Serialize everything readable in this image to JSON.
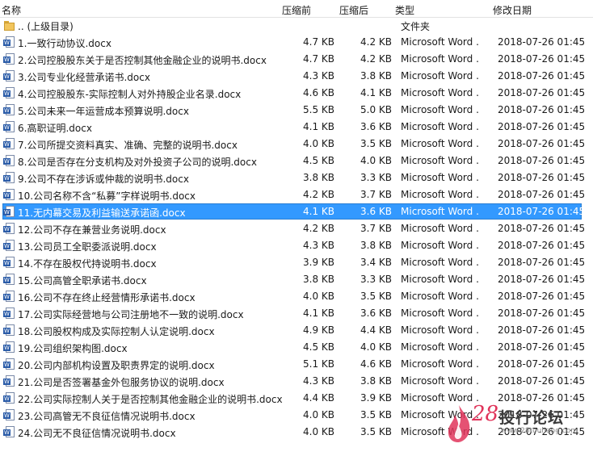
{
  "columns": {
    "name": "名称",
    "size_before": "压缩前",
    "size_after": "压缩后",
    "type": "类型",
    "modified": "修改日期"
  },
  "parent_row": {
    "label": ".. (上级目录)",
    "type": "文件夹",
    "icon": "folder-icon"
  },
  "selected_index": 10,
  "files": [
    {
      "name": "1.一致行动协议.docx",
      "before": "4.7 KB",
      "after": "4.2 KB",
      "type": "Microsoft Word ...",
      "date": "2018-07-26 01:45"
    },
    {
      "name": "2.公司控股股东关于是否控制其他金融企业的说明书.docx",
      "before": "4.7 KB",
      "after": "4.2 KB",
      "type": "Microsoft Word ...",
      "date": "2018-07-26 01:45"
    },
    {
      "name": "3.公司专业化经营承诺书.docx",
      "before": "4.3 KB",
      "after": "3.8 KB",
      "type": "Microsoft Word ...",
      "date": "2018-07-26 01:45"
    },
    {
      "name": "4.公司控股股东-实际控制人对外持股企业名录.docx",
      "before": "4.6 KB",
      "after": "4.1 KB",
      "type": "Microsoft Word ...",
      "date": "2018-07-26 01:45"
    },
    {
      "name": "5.公司未来一年运营成本预算说明.docx",
      "before": "5.5 KB",
      "after": "5.0 KB",
      "type": "Microsoft Word ...",
      "date": "2018-07-26 01:45"
    },
    {
      "name": "6.高职证明.docx",
      "before": "4.1 KB",
      "after": "3.6 KB",
      "type": "Microsoft Word ...",
      "date": "2018-07-26 01:45"
    },
    {
      "name": "7.公司所提交资料真实、准确、完整的说明书.docx",
      "before": "4.0 KB",
      "after": "3.5 KB",
      "type": "Microsoft Word ...",
      "date": "2018-07-26 01:45"
    },
    {
      "name": "8.公司是否存在分支机构及对外投资子公司的说明.docx",
      "before": "4.5 KB",
      "after": "4.0 KB",
      "type": "Microsoft Word ...",
      "date": "2018-07-26 01:45"
    },
    {
      "name": "9.公司不存在涉诉或仲裁的说明书.docx",
      "before": "3.8 KB",
      "after": "3.3 KB",
      "type": "Microsoft Word ...",
      "date": "2018-07-26 01:45"
    },
    {
      "name": "10.公司名称不含“私募”字样说明书.docx",
      "before": "4.2 KB",
      "after": "3.7 KB",
      "type": "Microsoft Word ...",
      "date": "2018-07-26 01:45"
    },
    {
      "name": "11.无内幕交易及利益输送承诺函.docx",
      "before": "4.1 KB",
      "after": "3.6 KB",
      "type": "Microsoft Word ...",
      "date": "2018-07-26 01:45"
    },
    {
      "name": "12.公司不存在兼营业务说明.docx",
      "before": "4.2 KB",
      "after": "3.7 KB",
      "type": "Microsoft Word ...",
      "date": "2018-07-26 01:45"
    },
    {
      "name": "13.公司员工全职委派说明.docx",
      "before": "4.3 KB",
      "after": "3.8 KB",
      "type": "Microsoft Word ...",
      "date": "2018-07-26 01:45"
    },
    {
      "name": "14.不存在股权代持说明书.docx",
      "before": "3.9 KB",
      "after": "3.4 KB",
      "type": "Microsoft Word ...",
      "date": "2018-07-26 01:45"
    },
    {
      "name": "15.公司高管全职承诺书.docx",
      "before": "3.8 KB",
      "after": "3.3 KB",
      "type": "Microsoft Word ...",
      "date": "2018-07-26 01:45"
    },
    {
      "name": "16.公司不存在终止经营情形承诺书.docx",
      "before": "4.0 KB",
      "after": "3.5 KB",
      "type": "Microsoft Word ...",
      "date": "2018-07-26 01:45"
    },
    {
      "name": "17.公司实际经营地与公司注册地不一致的说明.docx",
      "before": "4.1 KB",
      "after": "3.6 KB",
      "type": "Microsoft Word ...",
      "date": "2018-07-26 01:45"
    },
    {
      "name": "18.公司股权构成及实际控制人认定说明.docx",
      "before": "4.9 KB",
      "after": "4.4 KB",
      "type": "Microsoft Word ...",
      "date": "2018-07-26 01:45"
    },
    {
      "name": "19.公司组织架构图.docx",
      "before": "4.5 KB",
      "after": "4.0 KB",
      "type": "Microsoft Word ...",
      "date": "2018-07-26 01:45"
    },
    {
      "name": "20.公司内部机构设置及职责界定的说明.docx",
      "before": "5.1 KB",
      "after": "4.6 KB",
      "type": "Microsoft Word ...",
      "date": "2018-07-26 01:45"
    },
    {
      "name": "21.公司是否签署基金外包服务协议的说明.docx",
      "before": "4.3 KB",
      "after": "3.8 KB",
      "type": "Microsoft Word ...",
      "date": "2018-07-26 01:45"
    },
    {
      "name": "22.公司实际控制人关于是否控制其他金融企业的说明书.docx",
      "before": "4.4 KB",
      "after": "3.9 KB",
      "type": "Microsoft Word ...",
      "date": "2018-07-26 01:45"
    },
    {
      "name": "23.公司高管无不良征信情况说明书.docx",
      "before": "4.0 KB",
      "after": "3.5 KB",
      "type": "Microsoft Word ...",
      "date": "2018-07-26 01:45"
    },
    {
      "name": "24.公司无不良征信情况说明书.docx",
      "before": "4.0 KB",
      "after": "3.5 KB",
      "type": "Microsoft Word ...",
      "date": "2018-07-26 01:45"
    }
  ],
  "watermark": {
    "number": "28",
    "title": "投行论坛",
    "url": "www.28touhang.com"
  },
  "colors": {
    "selection": "#3399ff",
    "word_icon": "#2b5ca8",
    "folder": "#f2c55c",
    "watermark_accent": "#e0345a"
  }
}
